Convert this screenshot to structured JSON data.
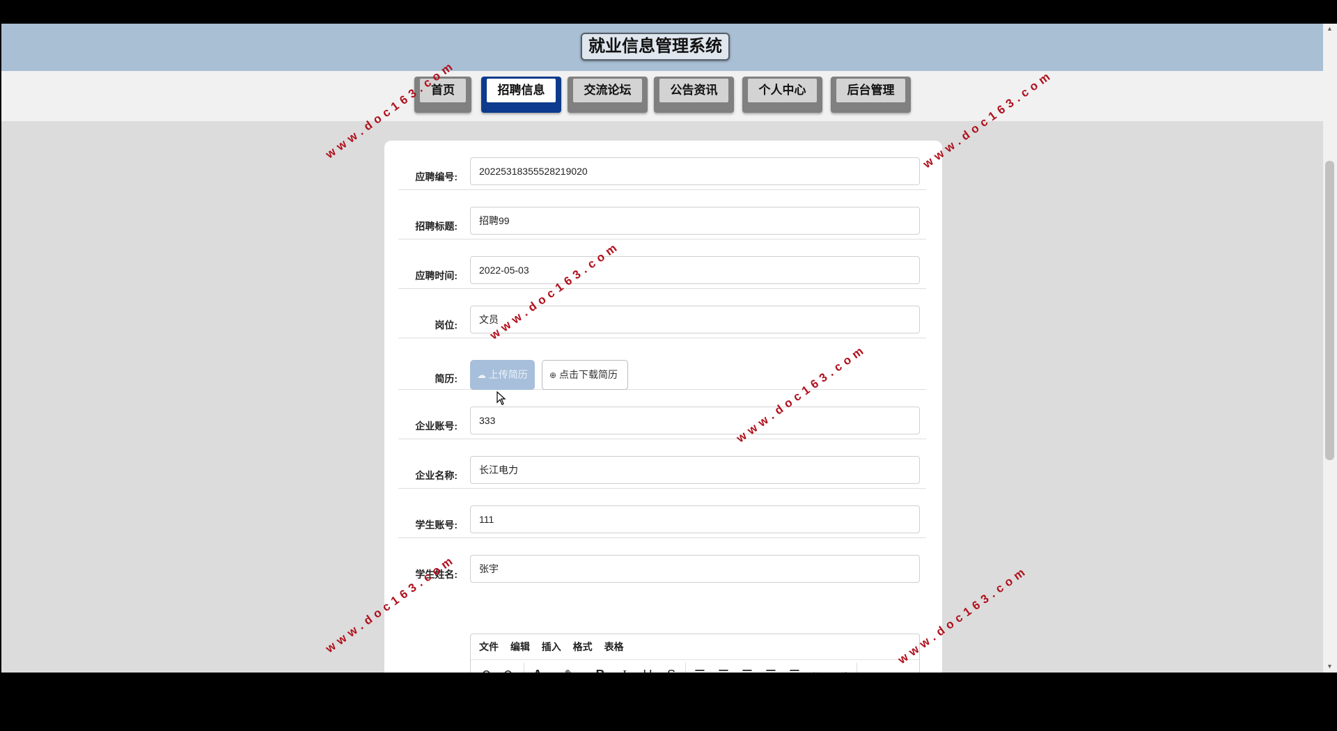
{
  "site_title": "就业信息管理系统",
  "nav": [
    "首页",
    "招聘信息",
    "交流论坛",
    "公告资讯",
    "个人中心",
    "后台管理"
  ],
  "active_nav": "招聘信息",
  "form": {
    "application_no": {
      "label": "应聘编号:",
      "value": "20225318355528219020"
    },
    "recruit_title": {
      "label": "招聘标题:",
      "value": "招聘99"
    },
    "apply_time": {
      "label": "应聘时间:",
      "value": "2022-05-03"
    },
    "position": {
      "label": "岗位:",
      "value": "文员"
    },
    "resume": {
      "label": "简历:",
      "upload_label": "上传简历",
      "download_label": "点击下载简历"
    },
    "company_account": {
      "label": "企业账号:",
      "value": "333"
    },
    "company_name": {
      "label": "企业名称:",
      "value": "长江电力"
    },
    "student_account": {
      "label": "学生账号:",
      "value": "111"
    },
    "student_name": {
      "label": "学生姓名:",
      "value": "张宇"
    }
  },
  "editor": {
    "menus": [
      "文件",
      "编辑",
      "插入",
      "格式",
      "表格"
    ]
  },
  "watermark": "www.doc163.com"
}
